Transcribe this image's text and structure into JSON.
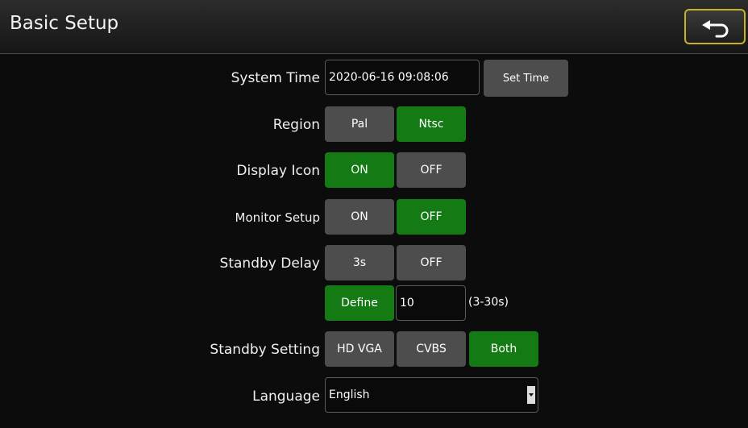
{
  "header": {
    "title": "Basic Setup"
  },
  "icons": {
    "back": "return-arrow-icon",
    "dropdown": "caret-down-icon"
  },
  "colors": {
    "active": "#147a14",
    "inactive": "#4d4d4d",
    "focus": "#c9b227"
  },
  "system_time": {
    "label": "System Time",
    "value": "2020-06-16 09:08:06",
    "button": "Set Time"
  },
  "region": {
    "label": "Region",
    "options": [
      "Pal",
      "Ntsc"
    ],
    "selected": "Ntsc"
  },
  "display_icon": {
    "label": "Display Icon",
    "options": [
      "ON",
      "OFF"
    ],
    "selected": "ON"
  },
  "monitor_setup": {
    "label": "Monitor Setup",
    "options": [
      "ON",
      "OFF"
    ],
    "selected": "OFF"
  },
  "standby_delay": {
    "label": "Standby Delay",
    "options": [
      "3s",
      "OFF"
    ],
    "define": "Define",
    "selected": "Define",
    "custom_value": "10",
    "range_hint": "(3-30s)"
  },
  "standby_setting": {
    "label": "Standby Setting",
    "options": [
      "HD VGA",
      "CVBS",
      "Both"
    ],
    "selected": "Both"
  },
  "language": {
    "label": "Language",
    "value": "English"
  }
}
